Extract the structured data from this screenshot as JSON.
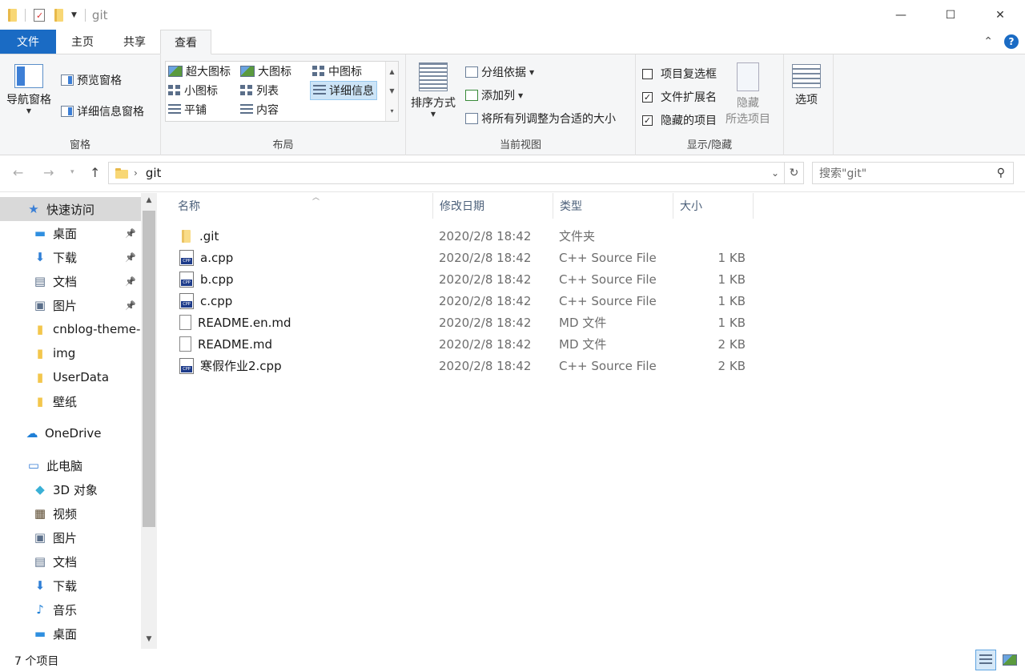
{
  "window": {
    "title": "git",
    "controls": {
      "minimize": "—",
      "maximize": "☐",
      "close": "✕"
    }
  },
  "ribbon_tabs": [
    "文件",
    "主页",
    "共享",
    "查看"
  ],
  "ribbon": {
    "panes": {
      "label": "窗格",
      "nav_pane": "导航窗格",
      "preview_pane": "预览窗格",
      "details_pane": "详细信息窗格"
    },
    "layout": {
      "label": "布局",
      "items": [
        "超大图标",
        "大图标",
        "中图标",
        "小图标",
        "列表",
        "详细信息",
        "平铺",
        "内容"
      ],
      "selected": "详细信息"
    },
    "current_view": {
      "label": "当前视图",
      "sort": "排序方式",
      "group_by": "分组依据",
      "add_column": "添加列",
      "fit_columns": "将所有列调整为合适的大小"
    },
    "show_hide": {
      "label": "显示/隐藏",
      "item_checkboxes": "项目复选框",
      "file_extensions": "文件扩展名",
      "hidden_items": "隐藏的项目",
      "hide_selected_line1": "隐藏",
      "hide_selected_line2": "所选项目",
      "options": "选项",
      "checked": {
        "item_checkboxes": false,
        "file_extensions": true,
        "hidden_items": true
      }
    }
  },
  "address": {
    "path": "git",
    "search_placeholder": "搜索\"git\""
  },
  "nav_pane": {
    "items": [
      {
        "label": "快速访问",
        "icon": "star-icon",
        "pinned": false
      },
      {
        "label": "桌面",
        "icon": "desktop-icon",
        "pinned": true
      },
      {
        "label": "下载",
        "icon": "download-icon",
        "pinned": true
      },
      {
        "label": "文档",
        "icon": "document-icon",
        "pinned": true
      },
      {
        "label": "图片",
        "icon": "pictures-icon",
        "pinned": true
      },
      {
        "label": "cnblog-theme-",
        "icon": "folder-icon",
        "pinned": false
      },
      {
        "label": "img",
        "icon": "folder-icon",
        "pinned": false
      },
      {
        "label": "UserData",
        "icon": "folder-icon",
        "pinned": false
      },
      {
        "label": "壁纸",
        "icon": "folder-icon",
        "pinned": false
      },
      {
        "label": "OneDrive",
        "icon": "cloud-icon",
        "pinned": false
      },
      {
        "label": "此电脑",
        "icon": "computer-icon",
        "pinned": false
      },
      {
        "label": "3D 对象",
        "icon": "cube-icon",
        "pinned": false
      },
      {
        "label": "视频",
        "icon": "video-icon",
        "pinned": false
      },
      {
        "label": "图片",
        "icon": "pictures-icon",
        "pinned": false
      },
      {
        "label": "文档",
        "icon": "document-icon",
        "pinned": false
      },
      {
        "label": "下载",
        "icon": "download-icon",
        "pinned": false
      },
      {
        "label": "音乐",
        "icon": "music-icon",
        "pinned": false
      },
      {
        "label": "桌面",
        "icon": "desktop-icon",
        "pinned": false
      }
    ]
  },
  "file_list": {
    "columns": [
      "名称",
      "修改日期",
      "类型",
      "大小"
    ],
    "rows": [
      {
        "name": ".git",
        "date": "2020/2/8 18:42",
        "type": "文件夹",
        "size": "",
        "icon": "folder-icon"
      },
      {
        "name": "a.cpp",
        "date": "2020/2/8 18:42",
        "type": "C++ Source File",
        "size": "1 KB",
        "icon": "cpp-file-icon"
      },
      {
        "name": "b.cpp",
        "date": "2020/2/8 18:42",
        "type": "C++ Source File",
        "size": "1 KB",
        "icon": "cpp-file-icon"
      },
      {
        "name": "c.cpp",
        "date": "2020/2/8 18:42",
        "type": "C++ Source File",
        "size": "1 KB",
        "icon": "cpp-file-icon"
      },
      {
        "name": "README.en.md",
        "date": "2020/2/8 18:42",
        "type": "MD 文件",
        "size": "1 KB",
        "icon": "md-file-icon"
      },
      {
        "name": "README.md",
        "date": "2020/2/8 18:42",
        "type": "MD 文件",
        "size": "2 KB",
        "icon": "md-file-icon"
      },
      {
        "name": "寒假作业2.cpp",
        "date": "2020/2/8 18:42",
        "type": "C++ Source File",
        "size": "2 KB",
        "icon": "cpp-file-icon"
      }
    ]
  },
  "status": {
    "count": "7 个项目"
  },
  "colors": {
    "accent": "#1a6bc4",
    "selected_bg": "#cce4f7",
    "folder": "#f8d775"
  }
}
